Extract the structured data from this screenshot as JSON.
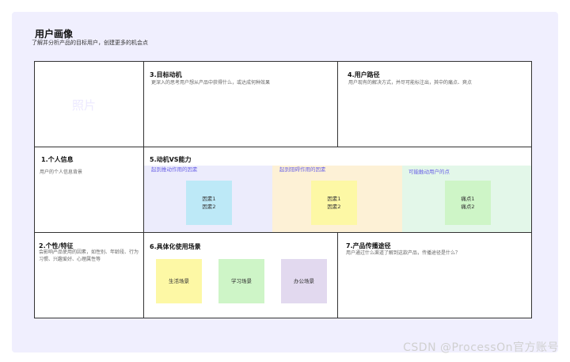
{
  "page": {
    "title": "用户画像",
    "subtitle": "了解并分析产品的目标用户，创建更多的机会点"
  },
  "photo_label": "照片",
  "cells": {
    "goal": {
      "title": "3.目标动机",
      "desc": "更深入的思考用户想从产品中获得什么，或达成何种效果"
    },
    "path": {
      "title": "4.用户路径",
      "desc": "用户现有的解决方式，并尽可能标注出，其中的痛点、爽点"
    },
    "personal": {
      "title": "1.个人信息",
      "desc": "用户的个人信息背景"
    },
    "motivation": {
      "title": "5.动机VS能力"
    },
    "traits": {
      "title": "2.个性/特征",
      "desc": "会影响产品使用的因素，如性别、年龄段、行为习惯、兴趣爱好、心理属性等"
    },
    "scenes": {
      "title": "6.具体化使用场景"
    },
    "channels": {
      "title": "7.产品传播途径",
      "desc": "用户通过什么渠道了解到这款产品，传播途径是什么？"
    }
  },
  "zones": [
    {
      "label": "起到推动作用的因素",
      "bg": "#ececfc",
      "color": "#6b63e6",
      "note_lines": [
        "因素1",
        "因素2"
      ],
      "note_color": "#bde9f7"
    },
    {
      "label": "起到阻碍作用的因素",
      "bg": "#fdf1d6",
      "color": "#6b63e6",
      "note_lines": [
        "因素1",
        "因素2"
      ],
      "note_color": "#fdf8a5"
    },
    {
      "label": "可能触动用户的点",
      "bg": "#e3f7e9",
      "color": "#6b63e6",
      "note_lines": [
        "痛点1",
        "痛点2"
      ],
      "note_color": "#cef5c7"
    }
  ],
  "scene_notes": [
    {
      "label": "生活场景",
      "color": "#fdf8a5"
    },
    {
      "label": "学习场景",
      "color": "#cef5c7"
    },
    {
      "label": "办公场景",
      "color": "#e2d9ef"
    }
  ],
  "watermark": "CSDN @ProcessOn官方账号"
}
